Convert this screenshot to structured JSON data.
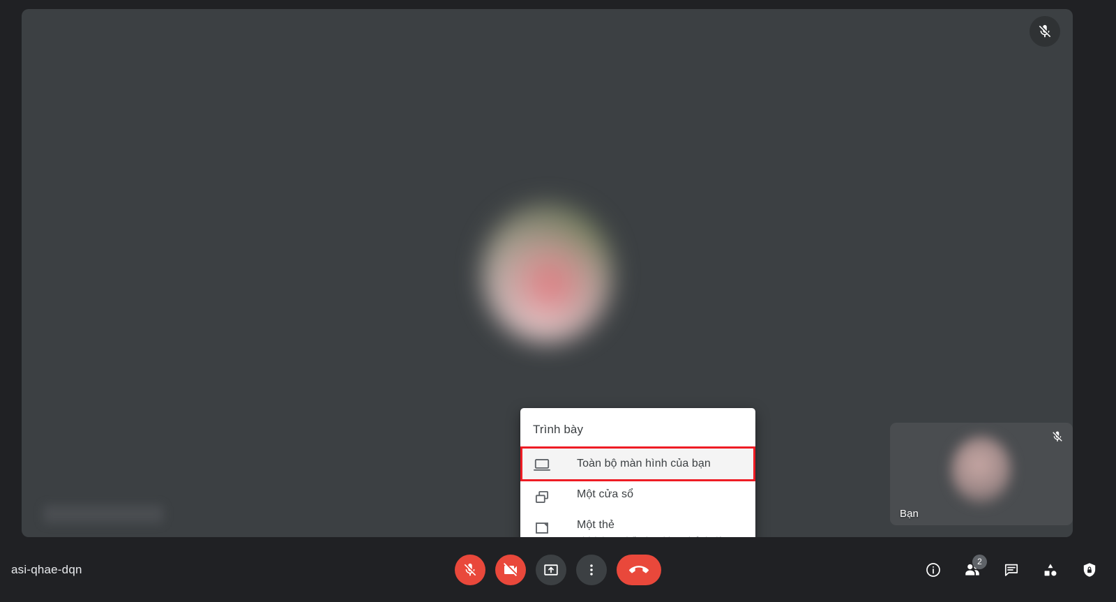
{
  "meeting": {
    "code": "asi-qhae-dqn",
    "main_tile": {
      "mic_state": "muted",
      "mic_icon": "mic-off-icon",
      "name_chip": ""
    },
    "self_view": {
      "label": "Bạn",
      "mic_state": "muted",
      "mic_icon": "mic-off-icon"
    }
  },
  "present_menu": {
    "title": "Trình bày",
    "items": [
      {
        "label": "Toàn bộ màn hình của bạn",
        "subtitle": "",
        "icon": "monitor-icon",
        "highlighted": true
      },
      {
        "label": "Một cửa sổ",
        "subtitle": "",
        "icon": "windows-icon",
        "highlighted": false
      },
      {
        "label": "Một thẻ",
        "subtitle": "Thích hợp nhất cho video và ảnh động",
        "icon": "tab-icon",
        "highlighted": false
      }
    ],
    "highlight_color": "#ee1c24"
  },
  "toolbar": {
    "center": [
      {
        "name": "microphone-button",
        "icon": "mic-off-icon",
        "state": "off",
        "label": "Tắt tiếng"
      },
      {
        "name": "camera-button",
        "icon": "video-off-icon",
        "state": "off",
        "label": "Tắt máy ảnh"
      },
      {
        "name": "present-button",
        "icon": "present-screen-icon",
        "state": "on",
        "label": "Trình bày ngay"
      },
      {
        "name": "more-options-button",
        "icon": "more-vertical-icon",
        "state": "on",
        "label": "Tùy chọn khác"
      },
      {
        "name": "end-call-button",
        "icon": "call-end-icon",
        "state": "on",
        "label": "Rời khỏi cuộc gọi"
      }
    ],
    "right": [
      {
        "name": "meeting-details-button",
        "icon": "info-icon",
        "label": "Chi tiết cuộc họp",
        "badge": ""
      },
      {
        "name": "participants-button",
        "icon": "people-icon",
        "label": "Hiển thị mọi người",
        "badge": "2"
      },
      {
        "name": "chat-button",
        "icon": "chat-icon",
        "label": "Trò chuyện với mọi người",
        "badge": ""
      },
      {
        "name": "activities-button",
        "icon": "activities-icon",
        "label": "Hoạt động",
        "badge": ""
      },
      {
        "name": "host-controls-button",
        "icon": "shield-lock-icon",
        "label": "Quyền kiểm soát của người tổ chức",
        "badge": ""
      }
    ]
  },
  "colors": {
    "background": "#202124",
    "tile": "#3c4043",
    "danger": "#e9483b",
    "menu_bg": "#ffffff",
    "highlight": "#ee1c24"
  }
}
